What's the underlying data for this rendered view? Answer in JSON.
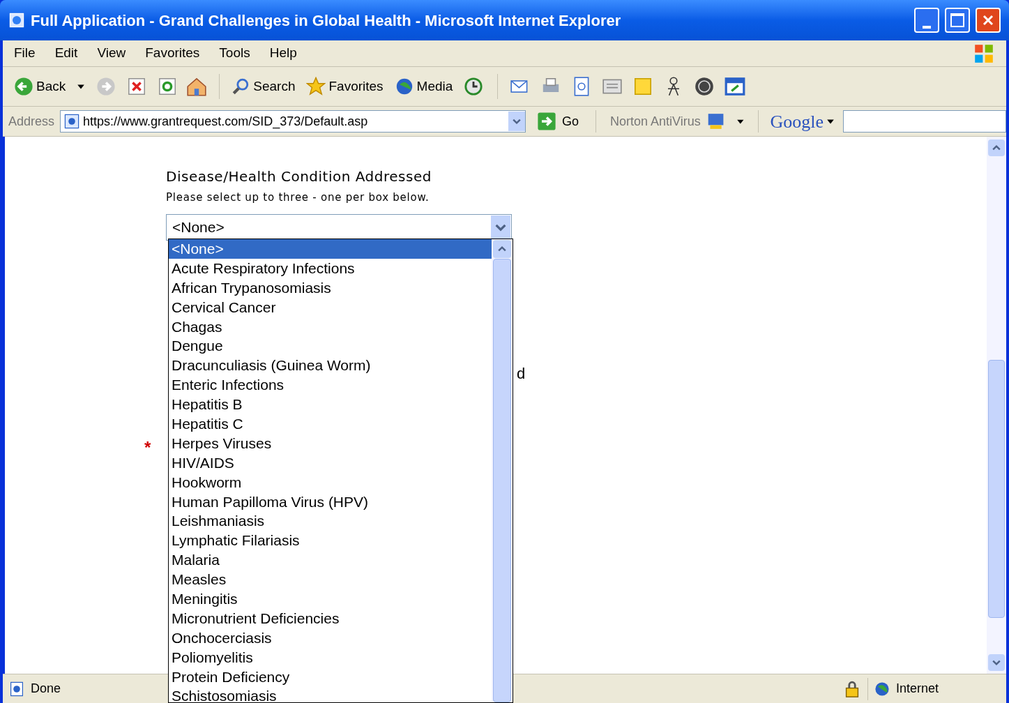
{
  "window": {
    "title": "Full Application - Grand Challenges in Global Health - Microsoft Internet Explorer"
  },
  "menu": [
    "File",
    "Edit",
    "View",
    "Favorites",
    "Tools",
    "Help"
  ],
  "toolbar": {
    "back": "Back",
    "search": "Search",
    "favorites": "Favorites",
    "media": "Media"
  },
  "address_bar": {
    "label": "Address",
    "url": "https://www.grantrequest.com/SID_373/Default.asp",
    "go": "Go",
    "norton": "Norton AntiVirus",
    "google": "Google"
  },
  "page": {
    "heading": "Disease/Health Condition Addressed",
    "hint": "Please select up to three - one per box below.",
    "select_value": "<None>",
    "hidden_text": "d",
    "required_mark": "*",
    "options": [
      {
        "label": "<None>",
        "selected": true
      },
      {
        "label": "Acute Respiratory Infections",
        "selected": false
      },
      {
        "label": "African Trypanosomiasis",
        "selected": false
      },
      {
        "label": "Cervical Cancer",
        "selected": false
      },
      {
        "label": "Chagas",
        "selected": false
      },
      {
        "label": "Dengue",
        "selected": false
      },
      {
        "label": "Dracunculiasis (Guinea Worm)",
        "selected": false
      },
      {
        "label": "Enteric Infections",
        "selected": false
      },
      {
        "label": "Hepatitis B",
        "selected": false
      },
      {
        "label": "Hepatitis C",
        "selected": false
      },
      {
        "label": "Herpes Viruses",
        "selected": false
      },
      {
        "label": "HIV/AIDS",
        "selected": false
      },
      {
        "label": "Hookworm",
        "selected": false
      },
      {
        "label": "Human Papilloma Virus (HPV)",
        "selected": false
      },
      {
        "label": "Leishmaniasis",
        "selected": false
      },
      {
        "label": "Lymphatic Filariasis",
        "selected": false
      },
      {
        "label": "Malaria",
        "selected": false
      },
      {
        "label": "Measles",
        "selected": false
      },
      {
        "label": "Meningitis",
        "selected": false
      },
      {
        "label": "Micronutrient Deficiencies",
        "selected": false
      },
      {
        "label": "Onchocerciasis",
        "selected": false
      },
      {
        "label": "Poliomyelitis",
        "selected": false
      },
      {
        "label": "Protein Deficiency",
        "selected": false
      },
      {
        "label": "Schistosomiasis",
        "selected": false
      }
    ]
  },
  "status_bar": {
    "status": "Done",
    "zone": "Internet"
  }
}
